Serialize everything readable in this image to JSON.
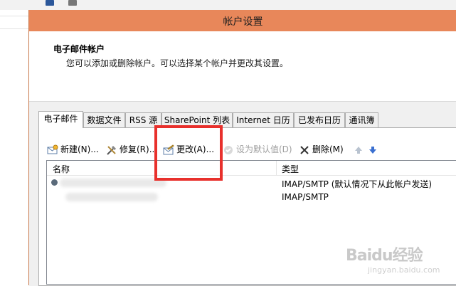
{
  "dialog": {
    "title": "帐户设置",
    "heading": "电子邮件帐户",
    "description": "您可以添加或删除帐户。可以选择某个帐户并更改其设置。"
  },
  "tabs": [
    {
      "label": "电子邮件",
      "active": true
    },
    {
      "label": "数据文件"
    },
    {
      "label": "RSS 源"
    },
    {
      "label": "SharePoint 列表"
    },
    {
      "label": "Internet 日历"
    },
    {
      "label": "已发布日历"
    },
    {
      "label": "通讯簿"
    }
  ],
  "toolbar": {
    "new_label": "新建(N)...",
    "repair_label": "修复(R)...",
    "change_label": "更改(A)...",
    "set_default_label": "设为默认值(D)",
    "delete_label": "删除(M)",
    "move_up_icon": "arrow-up-icon",
    "move_down_icon": "arrow-down-icon"
  },
  "list": {
    "columns": [
      "名称",
      "类型"
    ],
    "rows": [
      {
        "type": "IMAP/SMTP (默认情况下从此帐户发送)",
        "default": true
      },
      {
        "type": "IMAP/SMTP"
      }
    ]
  },
  "watermark": {
    "brand": "Baidu经验",
    "url": "jingyan.baidu.com"
  },
  "colors": {
    "titlebar": "#e8875a",
    "highlight": "#e8302c"
  }
}
